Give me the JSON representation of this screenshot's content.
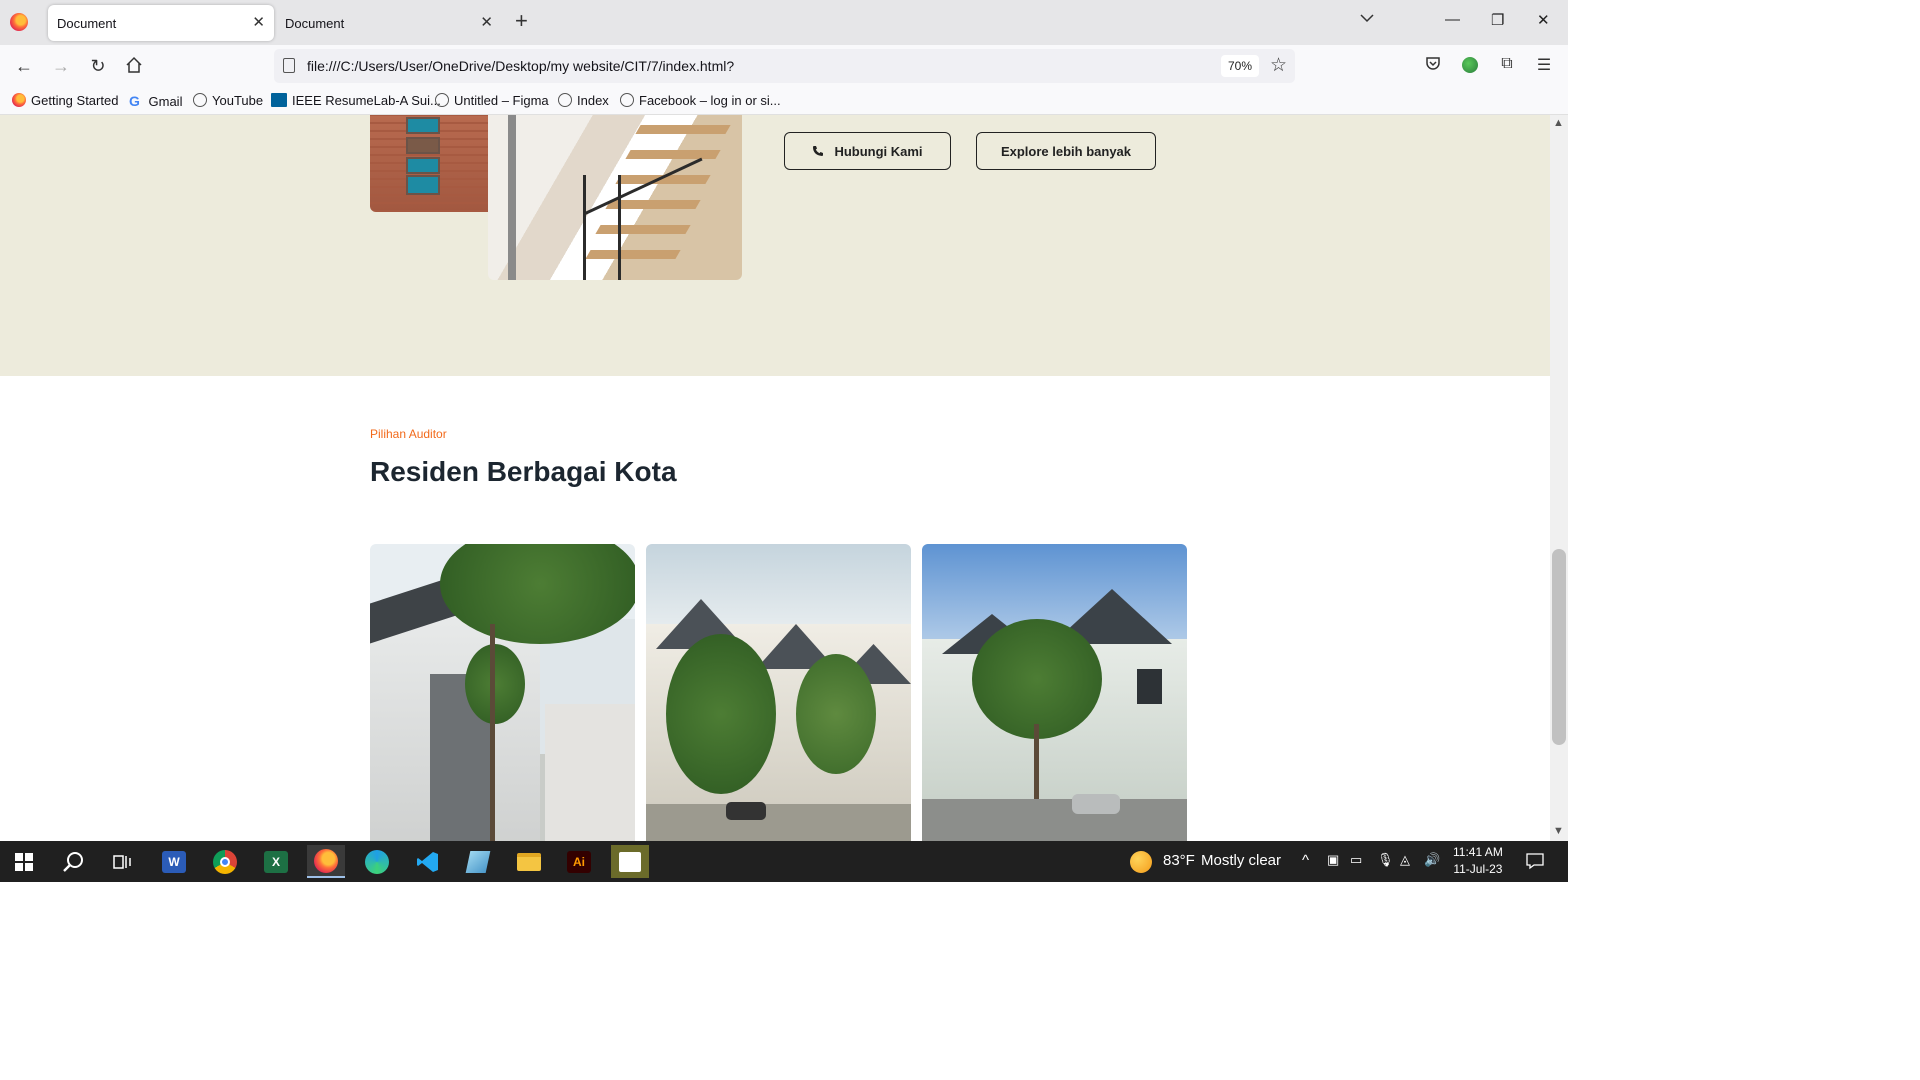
{
  "browser": {
    "tabs": [
      {
        "label": "Document",
        "active": true
      },
      {
        "label": "Document",
        "active": false
      }
    ],
    "url": "file:///C:/Users/User/OneDrive/Desktop/my website/CIT/7/index.html?",
    "zoom": "70%",
    "bookmarks": [
      {
        "label": "Getting Started",
        "icon": "firefox-icon"
      },
      {
        "label": "Gmail",
        "icon": "google-icon"
      },
      {
        "label": "YouTube",
        "icon": "globe-icon"
      },
      {
        "label": "IEEE ResumeLab-A Sui...",
        "icon": "ieee-icon"
      },
      {
        "label": "Untitled – Figma",
        "icon": "globe-icon"
      },
      {
        "label": "Index",
        "icon": "globe-icon"
      },
      {
        "label": "Facebook – log in or si...",
        "icon": "globe-icon"
      }
    ]
  },
  "hero": {
    "contact_button": "Hubungi Kami",
    "explore_button": "Explore lebih banyak"
  },
  "section": {
    "label": "Pilihan Auditor",
    "title": "Residen Berbagai Kota"
  },
  "taskbar": {
    "weather_temp": "83°F",
    "weather_text": "Mostly clear",
    "time": "11:41 AM",
    "date": "11-Jul-23"
  },
  "colors": {
    "hero_bg": "#edebdc",
    "accent_orange": "#f26a1b",
    "title_dark": "#1c2630"
  }
}
